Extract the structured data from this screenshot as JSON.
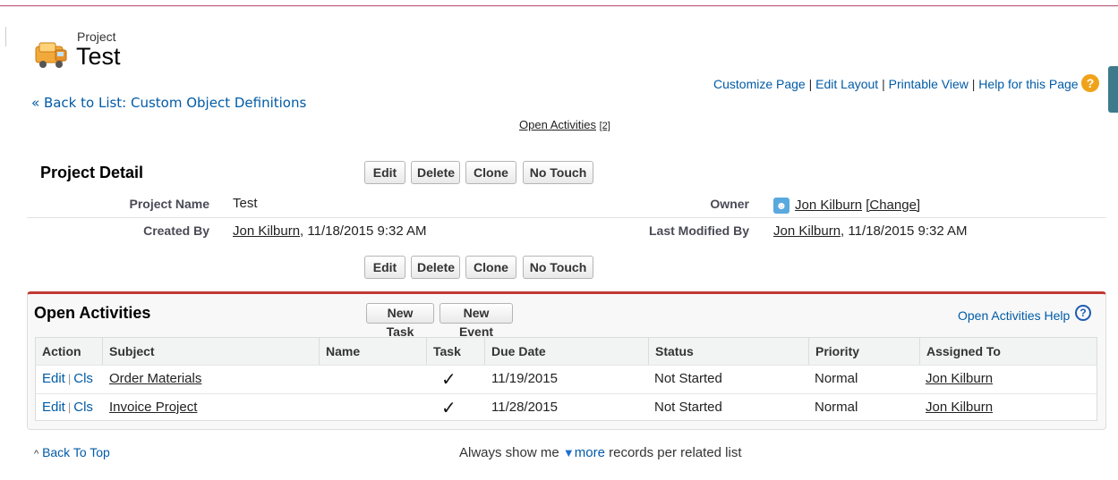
{
  "header": {
    "object_type": "Project",
    "record_name": "Test",
    "back_link": "« Back to List: Custom Object Definitions"
  },
  "top_links": {
    "customize": "Customize Page",
    "edit_layout": "Edit Layout",
    "printable": "Printable View",
    "help": "Help for this Page",
    "sep": "|"
  },
  "related_hover": {
    "label": "Open Activities",
    "count": "[2]"
  },
  "detail": {
    "title": "Project Detail",
    "buttons": {
      "edit": "Edit",
      "delete": "Delete",
      "clone": "Clone",
      "no_touch": "No Touch"
    },
    "project_name_label": "Project Name",
    "project_name_value": "Test",
    "owner_label": "Owner",
    "owner_name": "Jon Kilburn",
    "owner_change": "[Change]",
    "created_by_label": "Created By",
    "created_by_name": "Jon Kilburn",
    "created_by_date": ", 11/18/2015 9:32 AM",
    "last_modified_label": "Last Modified By",
    "last_modified_name": "Jon Kilburn",
    "last_modified_date": ", 11/18/2015 9:32 AM"
  },
  "open_activities": {
    "title": "Open Activities",
    "new_task": "New Task",
    "new_event": "New Event",
    "help": "Open Activities Help",
    "columns": [
      "Action",
      "Subject",
      "Name",
      "Task",
      "Due Date",
      "Status",
      "Priority",
      "Assigned To"
    ],
    "rows": [
      {
        "edit": "Edit",
        "sep": "|",
        "cls": "Cls",
        "subject": "Order Materials",
        "name": "",
        "task": "✓",
        "due": "11/19/2015",
        "status": "Not Started",
        "priority": "Normal",
        "assigned": "Jon Kilburn"
      },
      {
        "edit": "Edit",
        "sep": "|",
        "cls": "Cls",
        "subject": "Invoice Project",
        "name": "",
        "task": "✓",
        "due": "11/28/2015",
        "status": "Not Started",
        "priority": "Normal",
        "assigned": "Jon Kilburn"
      }
    ]
  },
  "footer": {
    "back_to_top": "Back To Top",
    "always_show": "Always show me",
    "more": "more",
    "records_text": "records per related list"
  },
  "colors": {
    "link": "#015ba7",
    "accent_red": "#c23934",
    "help_orange": "#f0a31a"
  }
}
